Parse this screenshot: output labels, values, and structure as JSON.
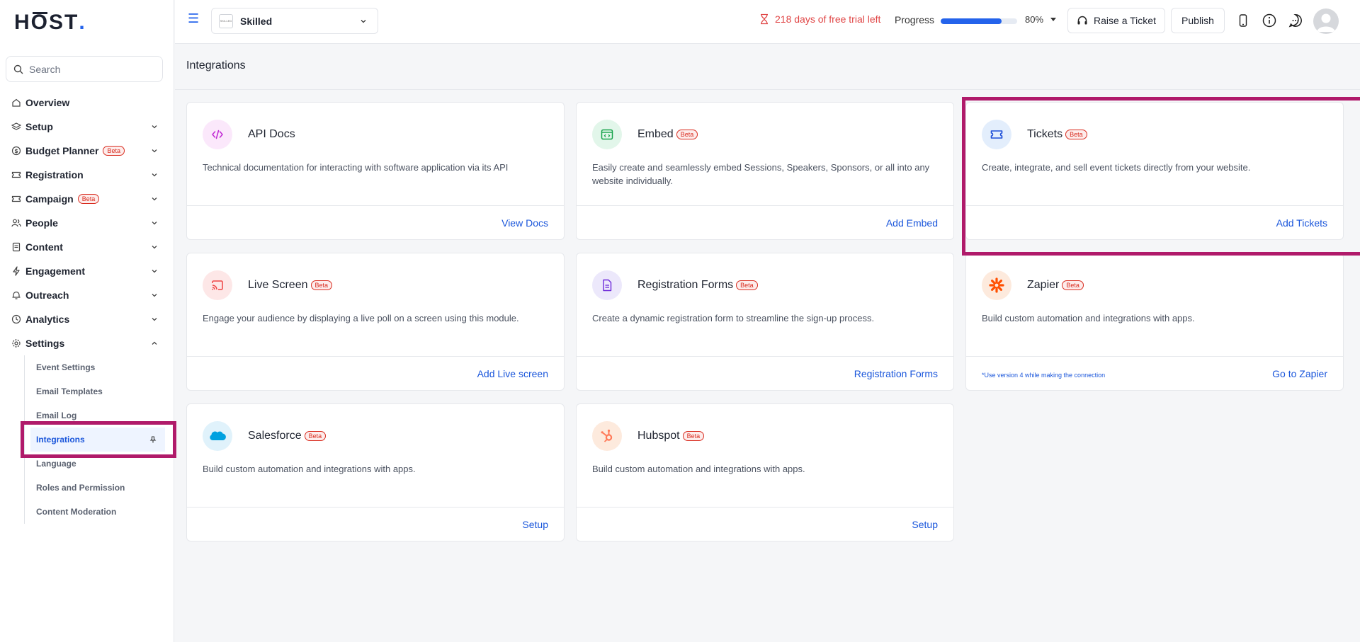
{
  "brand": {
    "logo_text_1": "H",
    "logo_text_2": "O",
    "logo_text_3": "ST",
    "logo_dot": "."
  },
  "search": {
    "placeholder": "Search"
  },
  "sidebar": {
    "items": [
      {
        "label": "Overview",
        "icon": "home-icon",
        "chevron": false
      },
      {
        "label": "Setup",
        "icon": "layers-icon",
        "chevron": true
      },
      {
        "label": "Budget Planner",
        "icon": "dollar-icon",
        "beta": "Beta",
        "chevron": true
      },
      {
        "label": "Registration",
        "icon": "ticket-icon",
        "chevron": true
      },
      {
        "label": "Campaign",
        "icon": "ticket-icon",
        "beta": "Beta",
        "chevron": true
      },
      {
        "label": "People",
        "icon": "users-icon",
        "chevron": true
      },
      {
        "label": "Content",
        "icon": "document-icon",
        "chevron": true
      },
      {
        "label": "Engagement",
        "icon": "bolt-icon",
        "chevron": true
      },
      {
        "label": "Outreach",
        "icon": "bell-icon",
        "chevron": true
      },
      {
        "label": "Analytics",
        "icon": "clock-icon",
        "chevron": true
      },
      {
        "label": "Settings",
        "icon": "gear-icon",
        "chevron": true,
        "expanded": true
      }
    ],
    "settings_sub": [
      "Event Settings",
      "Email Templates",
      "Email Log",
      "Integrations",
      "Language",
      "Roles and Permission",
      "Content Moderation"
    ]
  },
  "topbar": {
    "event_logo": "SKILLED",
    "event_name": "Skilled",
    "trial_text": "218 days of free trial left",
    "progress_label": "Progress",
    "progress_value": 80,
    "progress_text": "80%",
    "raise_ticket": "Raise a Ticket",
    "publish": "Publish"
  },
  "page": {
    "title": "Integrations"
  },
  "cards": [
    {
      "title": "API Docs",
      "beta": "",
      "desc": "Technical documentation for interacting with software application via its API",
      "action": "View Docs",
      "note": "",
      "icon": "code-icon",
      "icon_bg": "#fbe8fb",
      "icon_color": "#c026d3"
    },
    {
      "title": "Embed",
      "beta": "Beta",
      "desc": "Easily create and seamlessly embed Sessions, Speakers, Sponsors, or all into any website individually.",
      "action": "Add Embed",
      "note": "",
      "icon": "embed-icon",
      "icon_bg": "#e2f6ea",
      "icon_color": "#16a34a"
    },
    {
      "title": "Tickets",
      "beta": "Beta",
      "desc": "Create, integrate, and sell event tickets directly from your website.",
      "action": "Add Tickets",
      "note": "",
      "icon": "ticket-icon",
      "icon_bg": "#e3eefc",
      "icon_color": "#1d4ed8"
    },
    {
      "title": "Live Screen",
      "beta": "Beta",
      "desc": "Engage your audience by displaying a live poll on a screen using this module.",
      "action": "Add Live screen",
      "note": "",
      "icon": "cast-icon",
      "icon_bg": "#fde7e7",
      "icon_color": "#ef4444"
    },
    {
      "title": "Registration Forms",
      "beta": "Beta",
      "desc": "Create a dynamic registration form to streamline the sign-up process.",
      "action": "Registration Forms",
      "note": "",
      "icon": "form-icon",
      "icon_bg": "#ece8fb",
      "icon_color": "#6d28d9"
    },
    {
      "title": "Zapier",
      "beta": "Beta",
      "desc": "Build custom automation and integrations with apps.",
      "action": "Go to Zapier",
      "note": "*Use version 4 while making the connection",
      "icon": "zapier-icon",
      "icon_bg": "#fdeadd",
      "icon_color": "#ff4f00"
    },
    {
      "title": "Salesforce",
      "beta": "Beta",
      "desc": "Build custom automation and integrations with apps.",
      "action": "Setup",
      "note": "",
      "icon": "salesforce-icon",
      "icon_bg": "#e0f2fb",
      "icon_color": "#00a1e0"
    },
    {
      "title": "Hubspot",
      "beta": "Beta",
      "desc": "Build custom automation and integrations with apps.",
      "action": "Setup",
      "note": "",
      "icon": "hubspot-icon",
      "icon_bg": "#fdeadd",
      "icon_color": "#ff7a59"
    }
  ]
}
